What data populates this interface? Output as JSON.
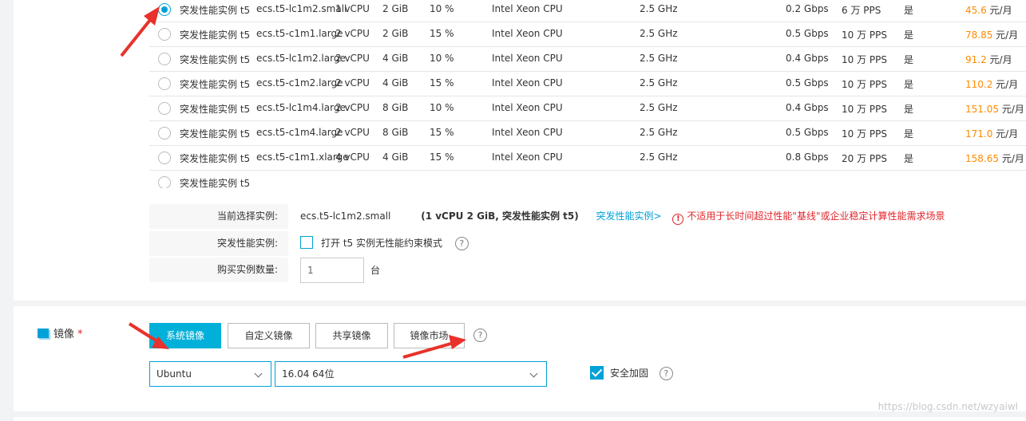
{
  "instances": [
    {
      "family": "突发性能实例 t5",
      "spec": "ecs.t5-lc1m2.small",
      "vcpu": "1 vCPU",
      "mem": "2 GiB",
      "baseline": "10 %",
      "cpu": "Intel Xeon CPU",
      "freq": "2.5 GHz",
      "bandwidth": "0.2 Gbps",
      "pps": "6 万 PPS",
      "ipv6": "是",
      "price": "45.6",
      "unit": " 元/月",
      "selected": true
    },
    {
      "family": "突发性能实例 t5",
      "spec": "ecs.t5-c1m1.large",
      "vcpu": "2 vCPU",
      "mem": "2 GiB",
      "baseline": "15 %",
      "cpu": "Intel Xeon CPU",
      "freq": "2.5 GHz",
      "bandwidth": "0.5 Gbps",
      "pps": "10 万 PPS",
      "ipv6": "是",
      "price": "78.85",
      "unit": " 元/月",
      "selected": false
    },
    {
      "family": "突发性能实例 t5",
      "spec": "ecs.t5-lc1m2.large",
      "vcpu": "2 vCPU",
      "mem": "4 GiB",
      "baseline": "10 %",
      "cpu": "Intel Xeon CPU",
      "freq": "2.5 GHz",
      "bandwidth": "0.4 Gbps",
      "pps": "10 万 PPS",
      "ipv6": "是",
      "price": "91.2",
      "unit": " 元/月",
      "selected": false
    },
    {
      "family": "突发性能实例 t5",
      "spec": "ecs.t5-c1m2.large",
      "vcpu": "2 vCPU",
      "mem": "4 GiB",
      "baseline": "15 %",
      "cpu": "Intel Xeon CPU",
      "freq": "2.5 GHz",
      "bandwidth": "0.5 Gbps",
      "pps": "10 万 PPS",
      "ipv6": "是",
      "price": "110.2",
      "unit": " 元/月",
      "selected": false
    },
    {
      "family": "突发性能实例 t5",
      "spec": "ecs.t5-lc1m4.large",
      "vcpu": "2 vCPU",
      "mem": "8 GiB",
      "baseline": "10 %",
      "cpu": "Intel Xeon CPU",
      "freq": "2.5 GHz",
      "bandwidth": "0.4 Gbps",
      "pps": "10 万 PPS",
      "ipv6": "是",
      "price": "151.05",
      "unit": " 元/月",
      "selected": false
    },
    {
      "family": "突发性能实例 t5",
      "spec": "ecs.t5-c1m4.large",
      "vcpu": "2 vCPU",
      "mem": "8 GiB",
      "baseline": "15 %",
      "cpu": "Intel Xeon CPU",
      "freq": "2.5 GHz",
      "bandwidth": "0.5 Gbps",
      "pps": "10 万 PPS",
      "ipv6": "是",
      "price": "171.0",
      "unit": " 元/月",
      "selected": false
    },
    {
      "family": "突发性能实例 t5",
      "spec": "ecs.t5-c1m1.xlarge",
      "vcpu": "4 vCPU",
      "mem": "4 GiB",
      "baseline": "15 %",
      "cpu": "Intel Xeon CPU",
      "freq": "2.5 GHz",
      "bandwidth": "0.8 Gbps",
      "pps": "20 万 PPS",
      "ipv6": "是",
      "price": "158.65",
      "unit": " 元/月",
      "selected": false
    },
    {
      "family": "突发性能实例 t5",
      "spec": "",
      "vcpu": "",
      "mem": "",
      "baseline": "",
      "cpu": "",
      "freq": "",
      "bandwidth": "",
      "pps": "",
      "ipv6": "",
      "price": "",
      "unit": "",
      "selected": false
    }
  ],
  "selection": {
    "current_label": "当前选择实例:",
    "current_spec": "ecs.t5-lc1m2.small",
    "current_detail": "(1 vCPU 2 GiB, 突发性能实例 t5)",
    "burst_link": "突发性能实例>",
    "warning": "不适用于长时间超过性能\"基线\"或企业稳定计算性能需求场景",
    "burst_label": "突发性能实例:",
    "burst_option": "打开 t5 实例无性能约束模式",
    "qty_label": "购买实例数量:",
    "qty_value": "1",
    "qty_unit": "台"
  },
  "image": {
    "title": "镜像",
    "required": "*",
    "tabs": [
      "系统镜像",
      "自定义镜像",
      "共享镜像",
      "镜像市场"
    ],
    "active_tab": 0,
    "os": "Ubuntu",
    "version": "16.04 64位",
    "secure_label": "安全加固"
  },
  "watermark": "https://blog.csdn.net/wzyaiwl",
  "colors": {
    "accent": "#00a1d6",
    "price": "#ff8a00",
    "warning": "#e0252b",
    "annotation": "#e8322b"
  }
}
